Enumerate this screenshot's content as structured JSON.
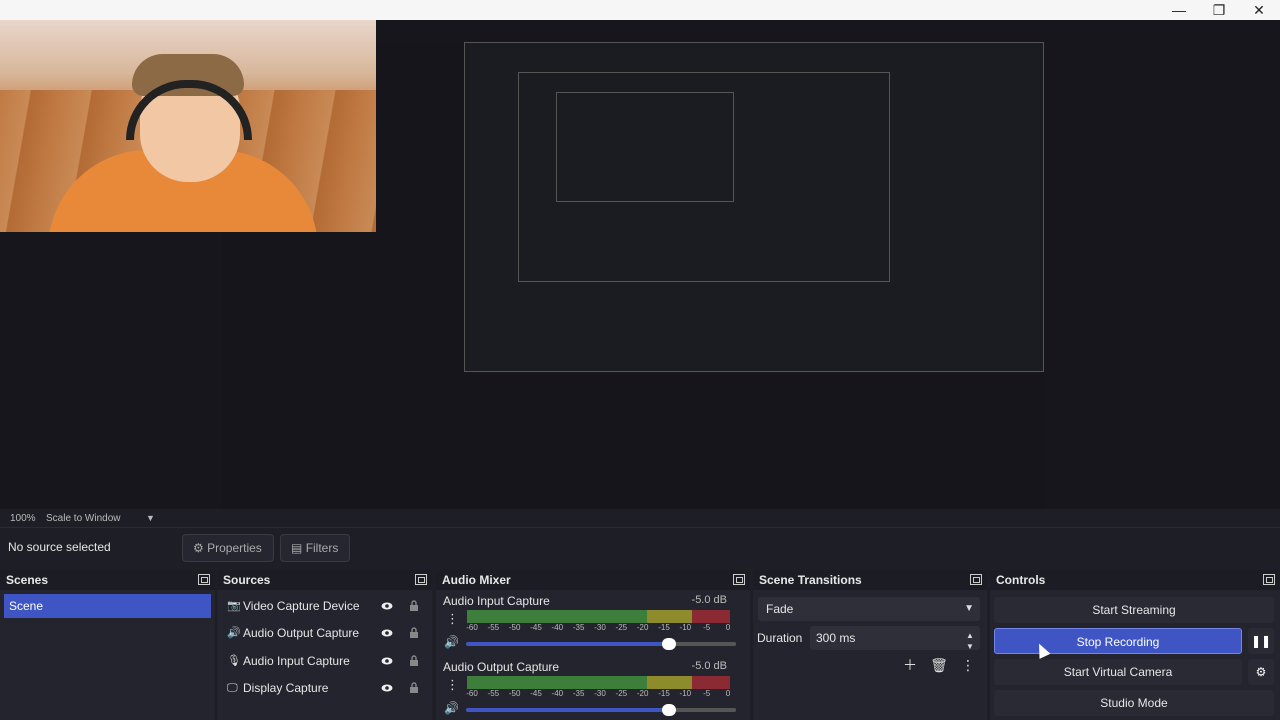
{
  "window": {
    "minimize_glyph": "—",
    "maximize_glyph": "❐",
    "close_glyph": "✕"
  },
  "preview_bar": {
    "zoom": "100%",
    "scale_mode": "Scale to Window",
    "dropdown_glyph": "▼"
  },
  "context_bar": {
    "selection_label": "No source selected",
    "properties_label": "Properties",
    "filters_label": "Filters"
  },
  "scenes": {
    "title": "Scenes",
    "items": [
      {
        "label": "Scene",
        "selected": true
      }
    ]
  },
  "sources": {
    "title": "Sources",
    "items": [
      {
        "label": "Video Capture Device",
        "icon": "camera-icon",
        "glyph": "📷"
      },
      {
        "label": "Audio Output Capture",
        "icon": "speaker-icon",
        "glyph": "🔊"
      },
      {
        "label": "Audio Input Capture",
        "icon": "microphone-icon",
        "glyph": "🎙"
      },
      {
        "label": "Display Capture",
        "icon": "monitor-icon",
        "glyph": "🖵"
      }
    ]
  },
  "audio_mixer": {
    "title": "Audio Mixer",
    "ticks": [
      "-60",
      "-55",
      "-50",
      "-45",
      "-40",
      "-35",
      "-30",
      "-25",
      "-20",
      "-15",
      "-10",
      "-5",
      "0"
    ],
    "channels": [
      {
        "name": "Audio Input Capture",
        "db": "-5.0 dB",
        "volume": 0.75
      },
      {
        "name": "Audio Output Capture",
        "db": "-5.0 dB",
        "volume": 0.75
      }
    ]
  },
  "scene_transitions": {
    "title": "Scene Transitions",
    "transition": "Fade",
    "duration_label": "Duration",
    "duration_value": "300 ms"
  },
  "controls": {
    "title": "Controls",
    "start_streaming": "Start Streaming",
    "stop_recording": "Stop Recording",
    "start_virtual_camera": "Start Virtual Camera",
    "studio_mode": "Studio Mode"
  },
  "colors": {
    "accent": "#3f55c4",
    "background": "#1e1e26",
    "dock": "#24242e",
    "meter_green": "#3e7e3b",
    "meter_yellow": "#8e8b2c",
    "meter_red": "#8b2a33"
  }
}
